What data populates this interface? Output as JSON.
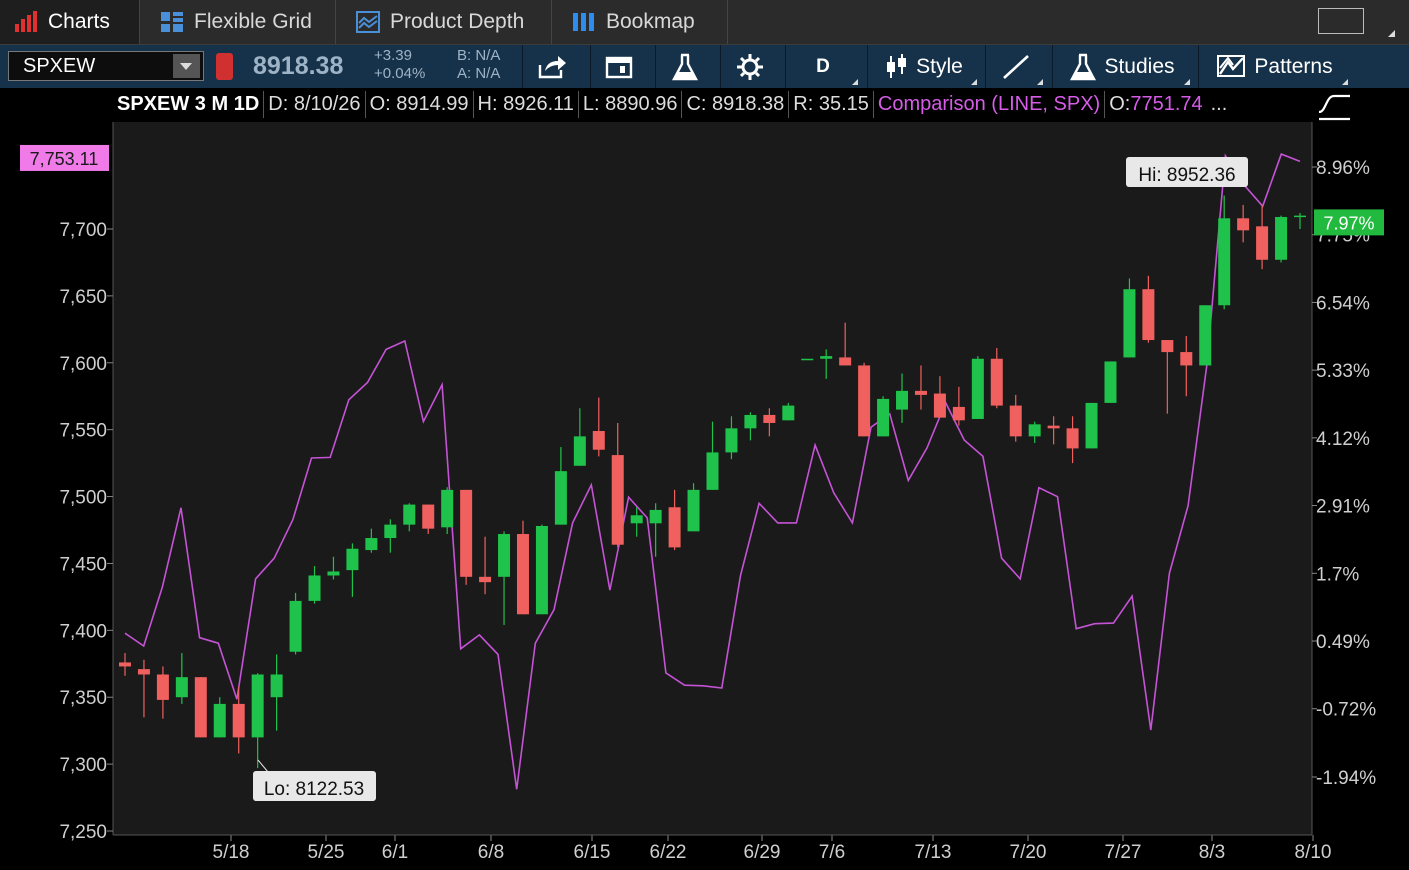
{
  "tabs": [
    {
      "label": "Charts",
      "icon": "bar-chart-icon"
    },
    {
      "label": "Flexible Grid",
      "icon": "grid-icon"
    },
    {
      "label": "Product Depth",
      "icon": "depth-icon"
    },
    {
      "label": "Bookmap",
      "icon": "bookmap-icon"
    }
  ],
  "toolbar": {
    "symbol": "SPXEW",
    "last": "8918.38",
    "change": "+3.39",
    "change_pct": "+0.04%",
    "bid": "B: N/A",
    "ask": "A: N/A",
    "aggregation": "D",
    "style_label": "Style",
    "studies_label": "Studies",
    "patterns_label": "Patterns"
  },
  "info": {
    "title": "SPXEW 3 M 1D",
    "date": "D: 8/10/26",
    "open": "O: 8914.99",
    "high": "H: 8926.11",
    "low": "L: 8890.96",
    "close": "C: 8918.38",
    "range": "R: 35.15",
    "comparison": "Comparison (LINE, SPX)",
    "comparison_open": "O: ",
    "comparison_open_value": "7751.74",
    "more": "..."
  },
  "colors": {
    "up": "#1fc24a",
    "down": "#f0605e",
    "comparison": "#c553d6",
    "badge_green": "#22b93f"
  },
  "chart_data": {
    "type": "candlestick",
    "title": "SPXEW 3 M 1D",
    "xlabel": "",
    "ylabel": "",
    "left_axis": {
      "ticks": [
        "7,250",
        "7,300",
        "7,350",
        "7,400",
        "7,450",
        "7,500",
        "7,550",
        "7,600",
        "7,650",
        "7,700"
      ],
      "range": [
        7250,
        7750
      ],
      "current_value_label": "7,753.11"
    },
    "right_axis": {
      "ticks": [
        "-1.94%",
        "-0.72%",
        "0.49%",
        "1.7%",
        "2.91%",
        "4.12%",
        "5.33%",
        "6.54%",
        "7.75%",
        "8.96%"
      ],
      "current_value_label": "7.97%"
    },
    "x_ticks": [
      "5/18",
      "5/25",
      "6/1",
      "6/8",
      "6/15",
      "6/22",
      "6/29",
      "7/6",
      "7/13",
      "7/20",
      "7/27",
      "8/3",
      "8/10"
    ],
    "annotations": {
      "high": "Hi: 8952.36",
      "low": "Lo: 8122.53"
    },
    "candles_scale": "left_axis",
    "candles": [
      {
        "o": 7376,
        "h": 7383,
        "l": 7366,
        "c": 7373
      },
      {
        "o": 7371,
        "h": 7378,
        "l": 7335,
        "c": 7367
      },
      {
        "o": 7367,
        "h": 7373,
        "l": 7334,
        "c": 7348
      },
      {
        "o": 7350,
        "h": 7383,
        "l": 7345,
        "c": 7365
      },
      {
        "o": 7365,
        "h": 7365,
        "l": 7320,
        "c": 7320
      },
      {
        "o": 7320,
        "h": 7350,
        "l": 7320,
        "c": 7345
      },
      {
        "o": 7345,
        "h": 7358,
        "l": 7308,
        "c": 7320
      },
      {
        "o": 7320,
        "h": 7368,
        "l": 7297,
        "c": 7367
      },
      {
        "o": 7350,
        "h": 7382,
        "l": 7325,
        "c": 7367
      },
      {
        "o": 7384,
        "h": 7428,
        "l": 7382,
        "c": 7422
      },
      {
        "o": 7422,
        "h": 7448,
        "l": 7420,
        "c": 7441
      },
      {
        "o": 7441,
        "h": 7455,
        "l": 7438,
        "c": 7444
      },
      {
        "o": 7445,
        "h": 7465,
        "l": 7425,
        "c": 7461
      },
      {
        "o": 7460,
        "h": 7476,
        "l": 7458,
        "c": 7469
      },
      {
        "o": 7469,
        "h": 7483,
        "l": 7458,
        "c": 7479
      },
      {
        "o": 7479,
        "h": 7495,
        "l": 7474,
        "c": 7494
      },
      {
        "o": 7494,
        "h": 7494,
        "l": 7472,
        "c": 7476
      },
      {
        "o": 7477,
        "h": 7507,
        "l": 7472,
        "c": 7505
      },
      {
        "o": 7505,
        "h": 7505,
        "l": 7434,
        "c": 7440
      },
      {
        "o": 7440,
        "h": 7470,
        "l": 7427,
        "c": 7436
      },
      {
        "o": 7440,
        "h": 7474,
        "l": 7404,
        "c": 7472
      },
      {
        "o": 7472,
        "h": 7482,
        "l": 7412,
        "c": 7412
      },
      {
        "o": 7412,
        "h": 7479,
        "l": 7412,
        "c": 7478
      },
      {
        "o": 7479,
        "h": 7537,
        "l": 7479,
        "c": 7519
      },
      {
        "o": 7523,
        "h": 7566,
        "l": 7523,
        "c": 7545
      },
      {
        "o": 7549,
        "h": 7574,
        "l": 7530,
        "c": 7535
      },
      {
        "o": 7531,
        "h": 7555,
        "l": 7462,
        "c": 7464
      },
      {
        "o": 7480,
        "h": 7492,
        "l": 7470,
        "c": 7486
      },
      {
        "o": 7480,
        "h": 7495,
        "l": 7455,
        "c": 7490
      },
      {
        "o": 7492,
        "h": 7505,
        "l": 7460,
        "c": 7462
      },
      {
        "o": 7474,
        "h": 7510,
        "l": 7474,
        "c": 7505
      },
      {
        "o": 7505,
        "h": 7556,
        "l": 7505,
        "c": 7533
      },
      {
        "o": 7533,
        "h": 7560,
        "l": 7528,
        "c": 7551
      },
      {
        "o": 7551,
        "h": 7563,
        "l": 7542,
        "c": 7561
      },
      {
        "o": 7561,
        "h": 7566,
        "l": 7545,
        "c": 7555
      },
      {
        "o": 7557,
        "h": 7570,
        "l": 7557,
        "c": 7568
      },
      {
        "o": 7603,
        "h": 7603,
        "l": 7603,
        "c": 7603
      },
      {
        "o": 7603,
        "h": 7610,
        "l": 7588,
        "c": 7605
      },
      {
        "o": 7604,
        "h": 7630,
        "l": 7600,
        "c": 7598
      },
      {
        "o": 7598,
        "h": 7600,
        "l": 7545,
        "c": 7545
      },
      {
        "o": 7545,
        "h": 7575,
        "l": 7545,
        "c": 7573
      },
      {
        "o": 7565,
        "h": 7592,
        "l": 7555,
        "c": 7579
      },
      {
        "o": 7579,
        "h": 7598,
        "l": 7565,
        "c": 7576
      },
      {
        "o": 7577,
        "h": 7590,
        "l": 7563,
        "c": 7559
      },
      {
        "o": 7567,
        "h": 7582,
        "l": 7553,
        "c": 7557
      },
      {
        "o": 7558,
        "h": 7605,
        "l": 7558,
        "c": 7603
      },
      {
        "o": 7603,
        "h": 7611,
        "l": 7566,
        "c": 7568
      },
      {
        "o": 7568,
        "h": 7576,
        "l": 7541,
        "c": 7545
      },
      {
        "o": 7545,
        "h": 7556,
        "l": 7540,
        "c": 7554
      },
      {
        "o": 7553,
        "h": 7560,
        "l": 7539,
        "c": 7551
      },
      {
        "o": 7551,
        "h": 7560,
        "l": 7525,
        "c": 7536
      },
      {
        "o": 7536,
        "h": 7570,
        "l": 7536,
        "c": 7570
      },
      {
        "o": 7570,
        "h": 7590,
        "l": 7570,
        "c": 7601
      },
      {
        "o": 7604,
        "h": 7663,
        "l": 7604,
        "c": 7655
      },
      {
        "o": 7655,
        "h": 7665,
        "l": 7615,
        "c": 7617
      },
      {
        "o": 7617,
        "h": 7615,
        "l": 7562,
        "c": 7608
      },
      {
        "o": 7608,
        "h": 7620,
        "l": 7575,
        "c": 7598
      },
      {
        "o": 7598,
        "h": 7642,
        "l": 7598,
        "c": 7643
      },
      {
        "o": 7643,
        "h": 7725,
        "l": 7640,
        "c": 7708
      },
      {
        "o": 7708,
        "h": 7718,
        "l": 7690,
        "c": 7699
      },
      {
        "o": 7702,
        "h": 7718,
        "l": 7670,
        "c": 7677
      },
      {
        "o": 7677,
        "h": 7710,
        "l": 7675,
        "c": 7709
      },
      {
        "o": 7710,
        "h": 7712,
        "l": 7700,
        "c": 7710
      }
    ],
    "series": [
      {
        "name": "SPX",
        "scale": "right_axis",
        "values_pct": [
          0.63,
          0.4,
          1.45,
          2.87,
          0.55,
          0.45,
          -0.55,
          1.6,
          1.97,
          2.66,
          3.76,
          3.77,
          4.8,
          5.11,
          5.7,
          5.85,
          4.41,
          5.07,
          0.35,
          0.6,
          0.25,
          -2.16,
          0.45,
          1.05,
          2.6,
          3.28,
          1.4,
          3.06,
          2.69,
          -0.08,
          -0.3,
          -0.31,
          -0.35,
          1.66,
          2.95,
          2.6,
          2.6,
          3.99,
          3.14,
          2.6,
          4.31,
          4.55,
          3.36,
          3.94,
          4.75,
          4.08,
          3.79,
          1.97,
          1.6,
          3.23,
          3.07,
          0.71,
          0.8,
          0.81,
          1.29,
          -1.1,
          1.7,
          2.91,
          5.4,
          9.16,
          8.64,
          8.26,
          9.19,
          9.06
        ]
      }
    ],
    "grid": false,
    "legend": "none"
  }
}
